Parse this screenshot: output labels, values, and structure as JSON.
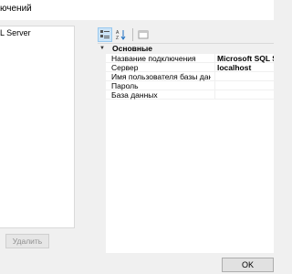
{
  "window": {
    "title": "ючений"
  },
  "connections": {
    "items": [
      {
        "label": "L Server"
      }
    ]
  },
  "buttons": {
    "delete_label": "Удалить",
    "ok_label": "OK"
  },
  "toolbar": {
    "icons": [
      "categorized-sort-icon",
      "alphabetical-sort-icon",
      "property-pages-icon"
    ]
  },
  "properties": {
    "category": "Основные",
    "rows": [
      {
        "name": "Название подключения",
        "value": "Microsoft SQL Server"
      },
      {
        "name": "Сервер",
        "value": "localhost"
      },
      {
        "name": "Имя пользователя базы данных",
        "value": ""
      },
      {
        "name": "Пароль",
        "value": ""
      },
      {
        "name": "База данных",
        "value": ""
      }
    ]
  },
  "colors": {
    "background": "#f0f0f0",
    "selected_toolbar_button": "#cce4f7",
    "disabled_text": "#8f8f8f"
  }
}
